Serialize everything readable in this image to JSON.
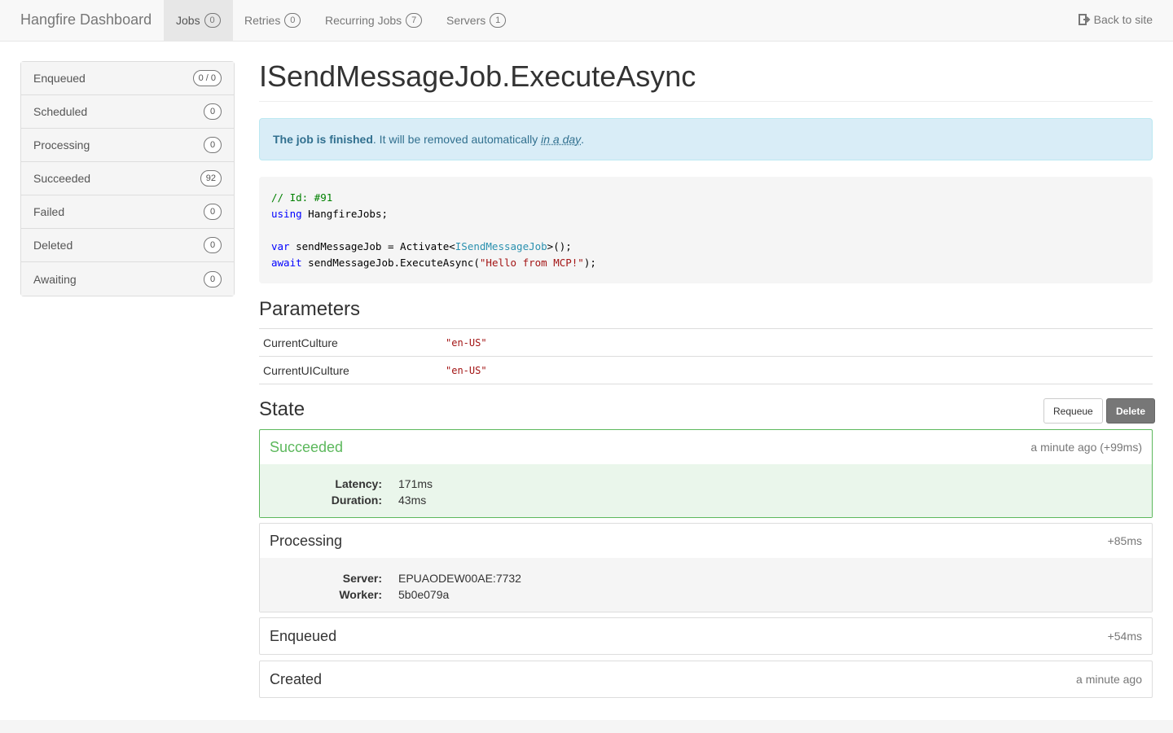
{
  "navbar": {
    "brand": "Hangfire Dashboard",
    "tabs": [
      {
        "label": "Jobs",
        "count": "0"
      },
      {
        "label": "Retries",
        "count": "0"
      },
      {
        "label": "Recurring Jobs",
        "count": "7"
      },
      {
        "label": "Servers",
        "count": "1"
      }
    ],
    "back_label": "Back to site",
    "back_icon": "sign-out-icon"
  },
  "sidebar": {
    "items": [
      {
        "label": "Enqueued",
        "count": "0 / 0"
      },
      {
        "label": "Scheduled",
        "count": "0"
      },
      {
        "label": "Processing",
        "count": "0"
      },
      {
        "label": "Succeeded",
        "count": "92"
      },
      {
        "label": "Failed",
        "count": "0"
      },
      {
        "label": "Deleted",
        "count": "0"
      },
      {
        "label": "Awaiting",
        "count": "0"
      }
    ]
  },
  "job": {
    "title": "ISendMessageJob.ExecuteAsync",
    "alert": {
      "bold": "The job is finished",
      "text": ". It will be removed automatically ",
      "time": "in a day",
      "end": "."
    },
    "code": {
      "comment": "// Id: #91",
      "using_kw": "using",
      "using_ns": " HangfireJobs;",
      "var_kw": "var",
      "var_rest": " sendMessageJob = Activate<",
      "var_type": "ISendMessageJob",
      "var_end": ">();",
      "await_kw": "await",
      "await_rest": " sendMessageJob.ExecuteAsync(",
      "await_str": "\"Hello from MCP!\"",
      "await_end": ");"
    }
  },
  "parameters": {
    "heading": "Parameters",
    "rows": [
      {
        "name": "CurrentCulture",
        "value": "\"en-US\""
      },
      {
        "name": "CurrentUICulture",
        "value": "\"en-US\""
      }
    ]
  },
  "state": {
    "heading": "State",
    "requeue_label": "Requeue",
    "delete_label": "Delete",
    "entries": [
      {
        "title": "Succeeded",
        "time": "a minute ago (+99ms)",
        "fields": [
          {
            "k": "Latency:",
            "v": "171ms"
          },
          {
            "k": "Duration:",
            "v": "43ms"
          }
        ]
      },
      {
        "title": "Processing",
        "time": "+85ms",
        "fields": [
          {
            "k": "Server:",
            "v": "EPUAODEW00AE:7732"
          },
          {
            "k": "Worker:",
            "v": "5b0e079a"
          }
        ]
      },
      {
        "title": "Enqueued",
        "time": "+54ms"
      },
      {
        "title": "Created",
        "time": "a minute ago"
      }
    ]
  },
  "colors": {
    "success": "#5cb85c",
    "info_bg": "#d9edf7",
    "info_text": "#31708f"
  }
}
